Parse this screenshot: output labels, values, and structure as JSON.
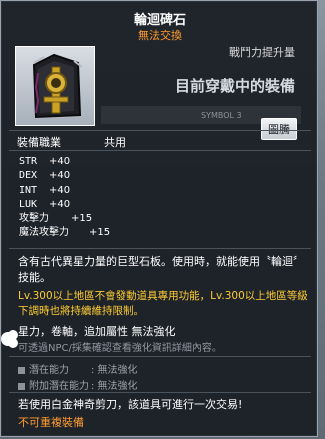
{
  "tooltip": {
    "title": "輪迴碑石",
    "subtitle": "無法交換",
    "power_label": "戰鬥力提升量",
    "wear_label": "目前穿戴中的裝備",
    "faint_text": "SYMBOL 3",
    "badge": "圖騰",
    "job_label": "裝備職業",
    "job_value": "共用",
    "stats": [
      {
        "key": "STR",
        "value": "+40"
      },
      {
        "key": "DEX",
        "value": "+40"
      },
      {
        "key": "INT",
        "value": "+40"
      },
      {
        "key": "LUK",
        "value": "+40"
      }
    ],
    "attack": {
      "key": "攻擊力",
      "value": "+15"
    },
    "magic_attack": {
      "key": "魔法攻擊力",
      "value": "+15"
    },
    "description": "含有古代異星力量的巨型石板。使用時，就能使用〝輪迴〞技能。",
    "warning": "Lv.300以上地區不會發動道具專用功能，Lv.300以上地區等級下調時也將持續維持限制。",
    "enhance": "星力，卷軸，追加屬性 無法強化",
    "hint": "可透過NPC/採集確認查看強化資訊詳細內容。",
    "potential": {
      "label": "潛在能力",
      "value": ": 無法強化"
    },
    "bonus_potential": {
      "label": "附加潛在能力",
      "value": ": 無法強化"
    },
    "scissor_note": "若使用白金神奇剪刀，該道具可進行一次交易!",
    "no_duplicate": "不可重複裝備"
  },
  "colors": {
    "title": "#ffffff",
    "accent_orange": "#ff9c2e",
    "warning_yellow": "#ffcc33",
    "muted_gray": "#8f98a1"
  },
  "icons": {
    "item": "totem-stone-icon",
    "bullet": "square-bullet-icon"
  }
}
